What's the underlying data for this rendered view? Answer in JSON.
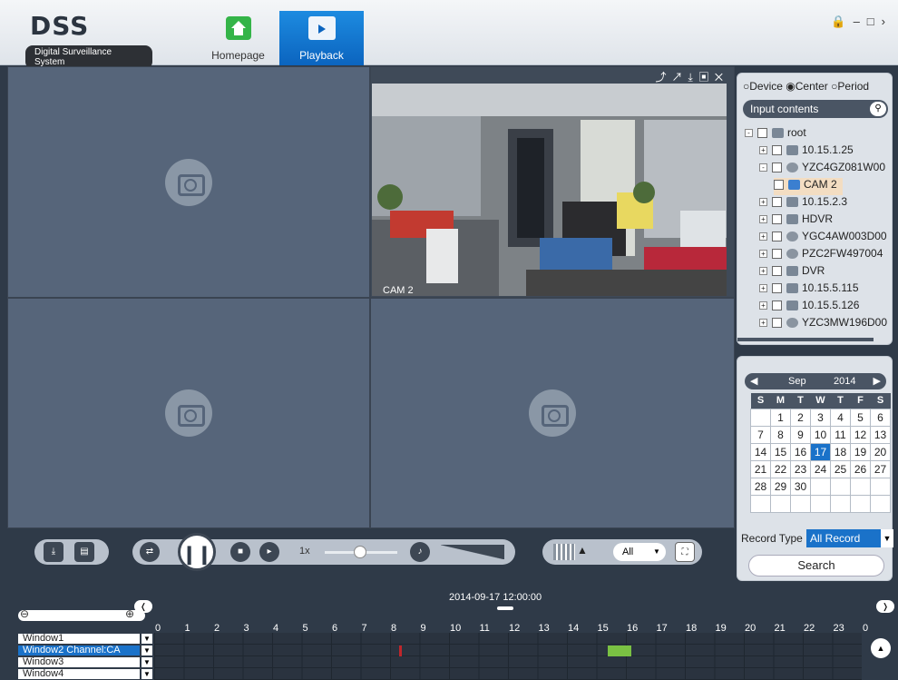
{
  "header": {
    "logo": "DSS",
    "logo_sub": "Digital Surveillance System",
    "nav": [
      {
        "label": "Homepage"
      },
      {
        "label": "Playback"
      }
    ]
  },
  "video": {
    "camera_label": "CAM 2"
  },
  "playback": {
    "speed": "1x",
    "window_mode": "All"
  },
  "sidebar": {
    "radios": [
      {
        "label": "Device",
        "checked": false
      },
      {
        "label": "Center",
        "checked": true
      },
      {
        "label": "Period",
        "checked": false
      }
    ],
    "search_placeholder": "Input contents",
    "tree": [
      {
        "label": "root",
        "level": 0,
        "expander": "-",
        "icon": "folder"
      },
      {
        "label": "10.15.1.25",
        "level": 1,
        "expander": "+",
        "icon": "device"
      },
      {
        "label": "YZC4GZ081W00",
        "level": 1,
        "expander": "-",
        "icon": "camera-device"
      },
      {
        "label": "CAM 2",
        "level": 2,
        "expander": "",
        "icon": "channel",
        "highlight": true
      },
      {
        "label": "10.15.2.3",
        "level": 1,
        "expander": "+",
        "icon": "device"
      },
      {
        "label": "HDVR",
        "level": 1,
        "expander": "+",
        "icon": "device"
      },
      {
        "label": "YGC4AW003D00",
        "level": 1,
        "expander": "+",
        "icon": "camera-device"
      },
      {
        "label": "PZC2FW497004",
        "level": 1,
        "expander": "+",
        "icon": "camera-device"
      },
      {
        "label": "DVR",
        "level": 1,
        "expander": "+",
        "icon": "device"
      },
      {
        "label": "10.15.5.115",
        "level": 1,
        "expander": "+",
        "icon": "device"
      },
      {
        "label": "10.15.5.126",
        "level": 1,
        "expander": "+",
        "icon": "device"
      },
      {
        "label": "YZC3MW196D00",
        "level": 1,
        "expander": "+",
        "icon": "camera-device"
      }
    ],
    "calendar": {
      "month": "Sep",
      "year": "2014",
      "weekdays": [
        "S",
        "M",
        "T",
        "W",
        "T",
        "F",
        "S"
      ],
      "weeks": [
        [
          "",
          "1",
          "2",
          "3",
          "4",
          "5",
          "6"
        ],
        [
          "7",
          "8",
          "9",
          "10",
          "11",
          "12",
          "13"
        ],
        [
          "14",
          "15",
          "16",
          "17",
          "18",
          "19",
          "20"
        ],
        [
          "21",
          "22",
          "23",
          "24",
          "25",
          "26",
          "27"
        ],
        [
          "28",
          "29",
          "30",
          "",
          "",
          "",
          ""
        ],
        [
          "",
          "",
          "",
          "",
          "",
          "",
          ""
        ]
      ],
      "selected": "17"
    },
    "record_type_label": "Record Type",
    "record_type_value": "All Record",
    "search_button": "Search"
  },
  "timeline": {
    "timestamp": "2014-09-17 12:00:00",
    "hours": [
      "0",
      "1",
      "2",
      "3",
      "4",
      "5",
      "6",
      "7",
      "8",
      "9",
      "10",
      "11",
      "12",
      "13",
      "14",
      "15",
      "16",
      "17",
      "18",
      "19",
      "20",
      "21",
      "22",
      "23",
      "0"
    ],
    "rows": [
      {
        "label": "Window1",
        "active": false
      },
      {
        "label": "Window2 Channel:CA",
        "active": true
      },
      {
        "label": "Window3",
        "active": false
      },
      {
        "label": "Window4",
        "active": false
      }
    ]
  },
  "colors": {
    "accent": "#1a72c9",
    "record_normal": "#7ac143",
    "record_alarm": "#c0262b"
  }
}
